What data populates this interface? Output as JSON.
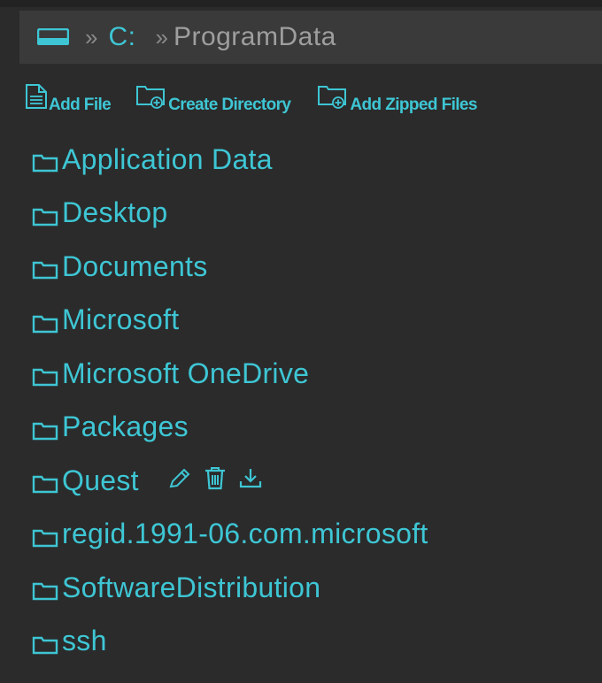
{
  "breadcrumb": {
    "drive_icon": "drive-icon",
    "separator": "»",
    "items": [
      {
        "label": "C:",
        "type": "link"
      },
      {
        "label": "ProgramData",
        "type": "current"
      }
    ]
  },
  "actions": {
    "add_file": {
      "label": "Add File",
      "icon": "file-icon"
    },
    "create_directory": {
      "label": "Create Directory",
      "icon": "folder-plus-icon"
    },
    "add_zipped_files": {
      "label": "Add Zipped Files",
      "icon": "folder-plus-icon"
    }
  },
  "folders": [
    {
      "name": "Application Data"
    },
    {
      "name": "Desktop"
    },
    {
      "name": "Documents"
    },
    {
      "name": "Microsoft"
    },
    {
      "name": "Microsoft OneDrive"
    },
    {
      "name": "Packages"
    },
    {
      "name": "Quest",
      "hovered": true,
      "row_actions": [
        "edit-icon",
        "trash-icon",
        "download-icon"
      ]
    },
    {
      "name": "regid.1991-06.com.microsoft"
    },
    {
      "name": "SoftwareDistribution"
    },
    {
      "name": "ssh"
    }
  ],
  "colors": {
    "background": "#2b2b2b",
    "bar": "#3a3a3a",
    "accent": "#3ec6d4",
    "muted": "#9e9e9e"
  }
}
